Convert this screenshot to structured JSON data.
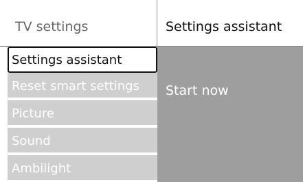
{
  "header": {
    "left_title": "TV settings",
    "right_title": "Settings assistant"
  },
  "menu": {
    "items": [
      {
        "label": "Settings assistant",
        "selected": true
      },
      {
        "label": "Reset smart settings",
        "selected": false
      },
      {
        "label": "Picture",
        "selected": false
      },
      {
        "label": "Sound",
        "selected": false
      },
      {
        "label": "Ambilight",
        "selected": false
      }
    ]
  },
  "panel": {
    "option": "Start now"
  },
  "colors": {
    "menu_bg": "#cfcfcf",
    "panel_bg": "#9e9e9e",
    "selected_border": "#111111"
  }
}
